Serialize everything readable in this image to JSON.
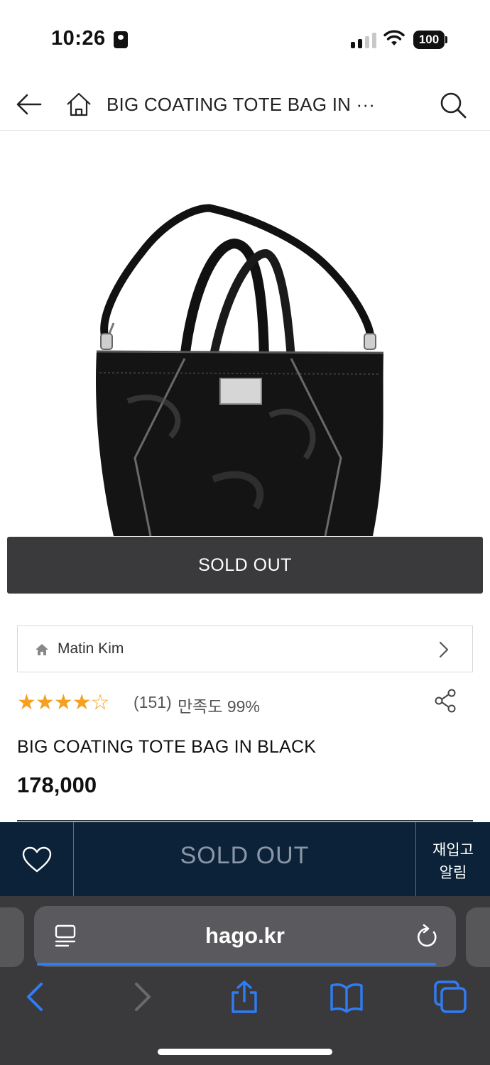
{
  "status_bar": {
    "time": "10:26",
    "battery": "100"
  },
  "header": {
    "title": "BIG COATING TOTE BAG IN ···"
  },
  "product": {
    "image_overlay": "SOLD OUT",
    "brand": "Matin Kim",
    "rating_value": 4,
    "rating_max": 5,
    "review_count": "(151)",
    "satisfaction": "만족도 99%",
    "title": "BIG COATING TOTE BAG IN BLACK",
    "price": "178,000"
  },
  "purchase_bar": {
    "soldout_label": "SOLD OUT",
    "restock_line1": "재입고",
    "restock_line2": "알림"
  },
  "browser": {
    "url": "hago.kr"
  },
  "colors": {
    "accent_star": "#f5a023",
    "purchase_bar_bg": "#0c2238",
    "soldout_banner_bg": "#3a3a3c",
    "safari_blue": "#2f7cf6"
  }
}
